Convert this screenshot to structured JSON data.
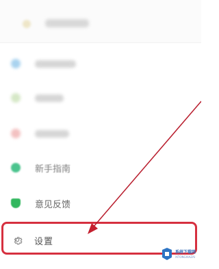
{
  "menu": {
    "blurred_items": [
      {
        "icon": "blue-circle-icon",
        "color": "#a9d3ef"
      },
      {
        "icon": "green-circle-icon",
        "color": "#d6e8c7"
      },
      {
        "icon": "pink-circle-icon",
        "color": "#f3c1c1"
      }
    ],
    "guide_item": {
      "label": "新手指南",
      "icon": "guide-icon",
      "color": "#4cc48e"
    },
    "feedback_item": {
      "label": "意见反馈",
      "icon": "feedback-icon",
      "color": "#32b75e"
    },
    "settings_item": {
      "label": "设置",
      "icon": "gear-icon"
    }
  },
  "annotation": {
    "highlight_color": "#d6303f",
    "arrow_color": "#b81c2c"
  },
  "watermark": {
    "text": "系统下载网",
    "subtext": "XITONGXIAZAI"
  }
}
